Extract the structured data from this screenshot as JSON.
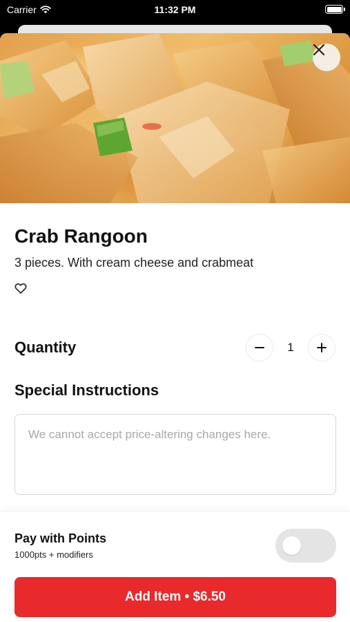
{
  "status_bar": {
    "carrier": "Carrier",
    "time": "11:32 PM",
    "wifi_icon": "wifi-icon",
    "battery_icon": "battery-icon"
  },
  "item": {
    "name": "Crab Rangoon",
    "description": "3 pieces. With cream cheese and crabmeat",
    "favorite_icon": "heart-outline-icon",
    "close_icon": "close-icon",
    "image": "crab-rangoon-photo"
  },
  "quantity": {
    "label": "Quantity",
    "value": "1",
    "decrement_icon": "minus-icon",
    "increment_icon": "plus-icon"
  },
  "special_instructions": {
    "label": "Special Instructions",
    "value": "",
    "placeholder": "We cannot accept price-altering changes here."
  },
  "footer": {
    "points_title": "Pay with Points",
    "points_subtitle": "1000pts + modifiers",
    "points_toggle_on": false,
    "add_button_label": "Add Item • $6.50"
  },
  "colors": {
    "accent": "#e82a2d",
    "toggle_off": "#e4e4e4"
  }
}
